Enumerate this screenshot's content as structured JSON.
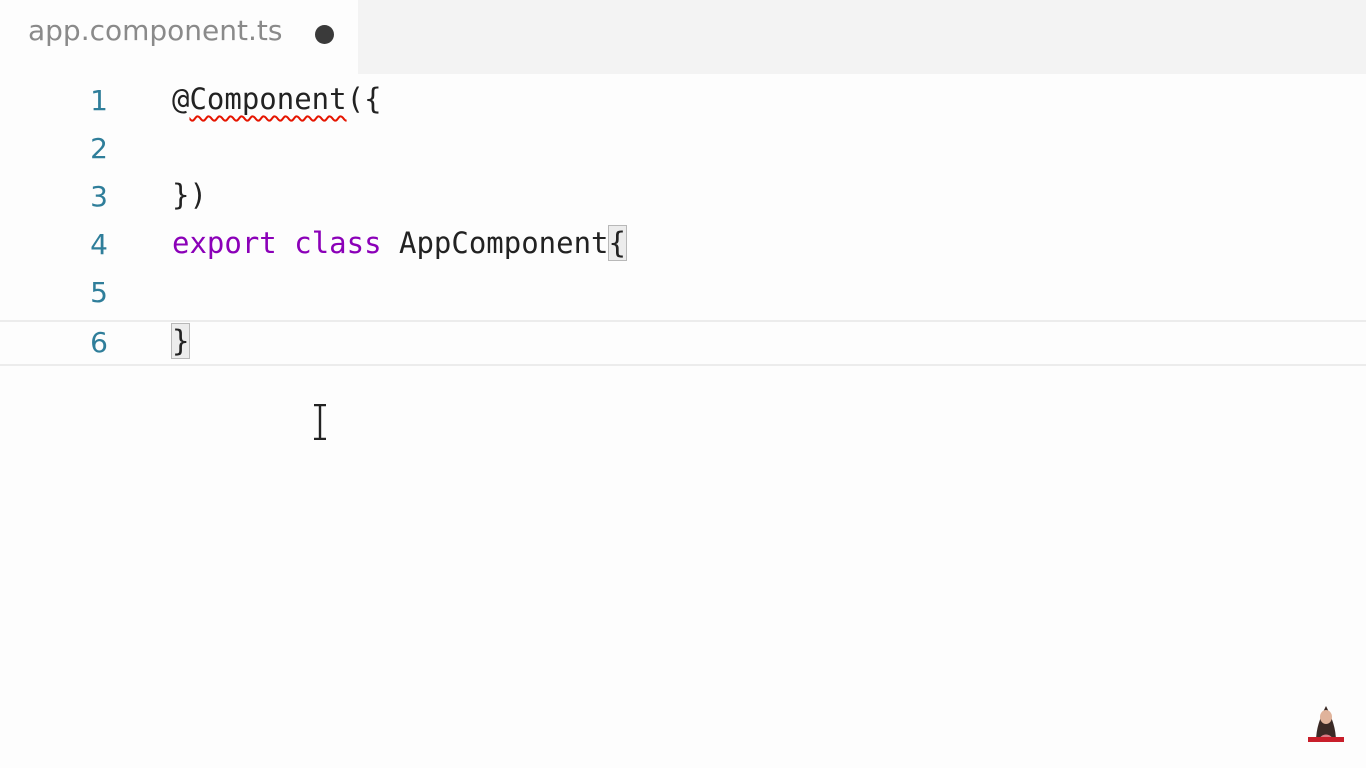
{
  "tab": {
    "filename": "app.component.ts",
    "dirty": true
  },
  "editor": {
    "lines": [
      {
        "number": "1",
        "segments": [
          {
            "text": "@",
            "kind": "plain"
          },
          {
            "text": "Component",
            "kind": "error"
          },
          {
            "text": "({",
            "kind": "plain"
          }
        ]
      },
      {
        "number": "2",
        "segments": []
      },
      {
        "number": "3",
        "segments": [
          {
            "text": "})",
            "kind": "plain"
          }
        ]
      },
      {
        "number": "4",
        "segments": [
          {
            "text": "export",
            "kind": "keyword"
          },
          {
            "text": " ",
            "kind": "plain"
          },
          {
            "text": "class",
            "kind": "keyword"
          },
          {
            "text": " AppComponent",
            "kind": "plain"
          },
          {
            "text": "{",
            "kind": "bracket-match"
          }
        ]
      },
      {
        "number": "5",
        "segments": []
      },
      {
        "number": "6",
        "segments": [
          {
            "text": "}",
            "kind": "bracket-match"
          }
        ]
      }
    ],
    "current_line": "6"
  },
  "colors": {
    "line_number": "#2f7e9a",
    "keyword": "#8b00b8",
    "error_squiggle": "#e51400",
    "text": "#222222",
    "tab_label": "#8a8a8a"
  },
  "icons": {
    "dirty_indicator": "dirty-dot-icon",
    "cursor": "text-cursor-icon",
    "channel_badge": "subscribe-avatar-icon"
  }
}
